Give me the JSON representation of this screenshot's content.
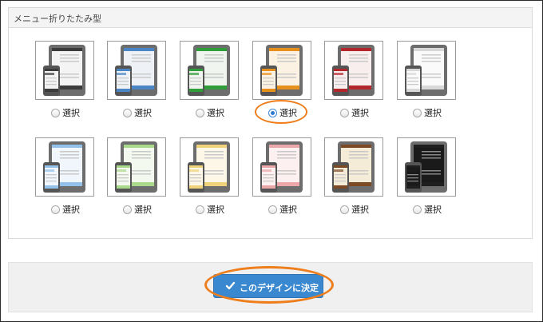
{
  "section": {
    "title": "メニュー折りたたみ型"
  },
  "options": [
    {
      "id": "black",
      "label": "選択",
      "checked": false,
      "accent": "#3c3c3c",
      "light": "#f4f4f4",
      "dark": false
    },
    {
      "id": "blue",
      "label": "選択",
      "checked": false,
      "accent": "#4a86c5",
      "light": "#eef2f7",
      "dark": false
    },
    {
      "id": "green",
      "label": "選択",
      "checked": false,
      "accent": "#2e9d3a",
      "light": "#f0f6ef",
      "dark": false
    },
    {
      "id": "orange",
      "label": "選択",
      "checked": true,
      "accent": "#e8901c",
      "light": "#fbf2e3",
      "dark": false
    },
    {
      "id": "red",
      "label": "選択",
      "checked": false,
      "accent": "#b3262c",
      "light": "#f8eeee",
      "dark": false
    },
    {
      "id": "white",
      "label": "選択",
      "checked": false,
      "accent": "#d8d8d8",
      "light": "#fafafa",
      "dark": false
    },
    {
      "id": "light-blue",
      "label": "選択",
      "checked": false,
      "accent": "#93c1ea",
      "light": "#f1f6fc",
      "dark": false
    },
    {
      "id": "light-green",
      "label": "選択",
      "checked": false,
      "accent": "#a9d98a",
      "light": "#f3f9ee",
      "dark": false
    },
    {
      "id": "yellow",
      "label": "選択",
      "checked": false,
      "accent": "#efd27a",
      "light": "#fcf7e6",
      "dark": false
    },
    {
      "id": "pink",
      "label": "選択",
      "checked": false,
      "accent": "#eaa6a9",
      "light": "#fcf0f0",
      "dark": false
    },
    {
      "id": "brown",
      "label": "選択",
      "checked": false,
      "accent": "#7d4a26",
      "light": "#f5ecd8",
      "dark": false
    },
    {
      "id": "dark",
      "label": "選択",
      "checked": false,
      "accent": "#1f1f1f",
      "light": "#2a2a2a",
      "dark": true
    }
  ],
  "actions": {
    "submit_label": "このデザインに決定"
  },
  "colors": {
    "highlight": "#ee7d1b",
    "button": "#3a88cf"
  }
}
